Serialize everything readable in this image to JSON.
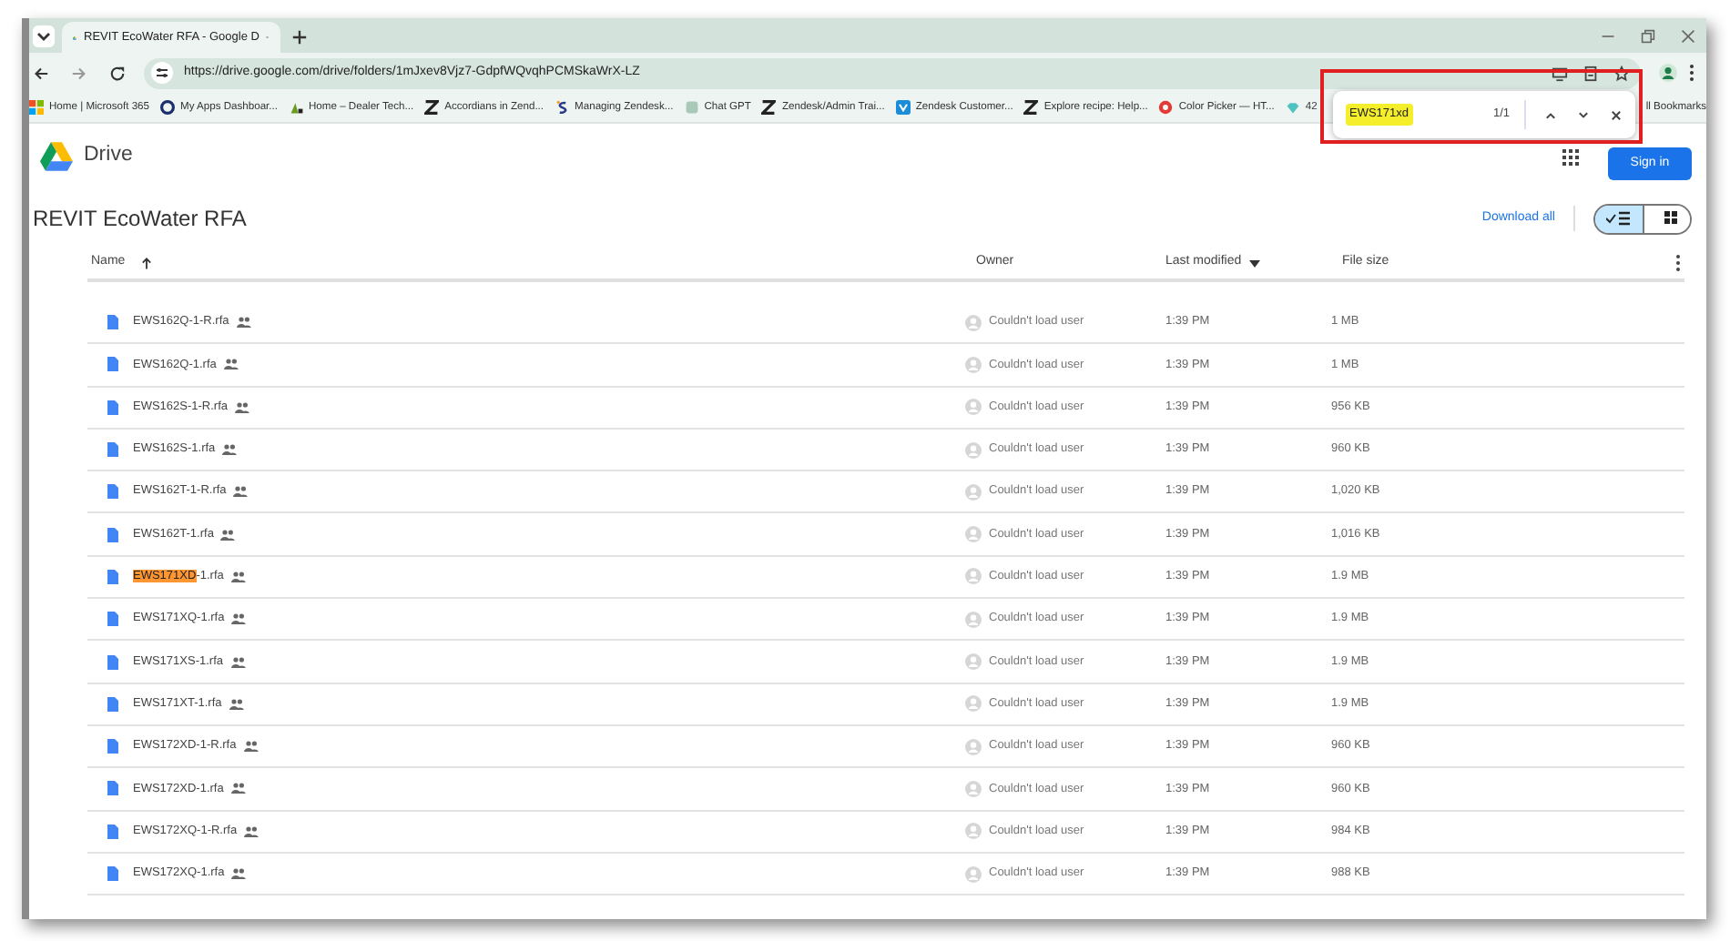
{
  "browser": {
    "tab": {
      "title": "REVIT EcoWater RFA - Google D",
      "selected": true
    },
    "url": "https://drive.google.com/drive/folders/1mJxev8Vjz7-GdpfWQvqhPCMSkaWrX-LZ",
    "bookmarks": [
      "Home | Microsoft 365",
      "My Apps Dashboar...",
      "Home – Dealer Tech...",
      "Accordians in Zend...",
      "Managing Zendesk...",
      "Chat GPT",
      "Zendesk/Admin Trai...",
      "Zendesk Customer...",
      "Explore recipe: Help...",
      "Color Picker — HT...",
      "42"
    ],
    "bookmarks_end": "ll Bookmarks",
    "find_bar": {
      "query": "EWS171xd",
      "count": "1/1"
    }
  },
  "drive": {
    "logo_text": "Drive",
    "sign_in": "Sign in",
    "folder_title": "REVIT EcoWater RFA",
    "download_all": "Download all",
    "view_toggle": [
      {
        "kind": "list",
        "selected": true
      },
      {
        "kind": "grid",
        "selected": false
      }
    ],
    "columns": [
      "Name",
      "Owner",
      "Last modified",
      "File size"
    ],
    "rows": [
      {
        "name": "EWS162Q-1-R.rfa",
        "owner": "Couldn't load user",
        "modified": "1:39 PM",
        "size": "1 MB"
      },
      {
        "name": "EWS162Q-1.rfa",
        "owner": "Couldn't load user",
        "modified": "1:39 PM",
        "size": "1 MB"
      },
      {
        "name": "EWS162S-1-R.rfa",
        "owner": "Couldn't load user",
        "modified": "1:39 PM",
        "size": "956 KB"
      },
      {
        "name": "EWS162S-1.rfa",
        "owner": "Couldn't load user",
        "modified": "1:39 PM",
        "size": "960 KB"
      },
      {
        "name": "EWS162T-1-R.rfa",
        "owner": "Couldn't load user",
        "modified": "1:39 PM",
        "size": "1,020 KB"
      },
      {
        "name": "EWS162T-1.rfa",
        "owner": "Couldn't load user",
        "modified": "1:39 PM",
        "size": "1,016 KB"
      },
      {
        "match": "EWS171XD",
        "name": "-1.rfa",
        "owner": "Couldn't load user",
        "modified": "1:39 PM",
        "size": "1.9 MB"
      },
      {
        "name": "EWS171XQ-1.rfa",
        "owner": "Couldn't load user",
        "modified": "1:39 PM",
        "size": "1.9 MB"
      },
      {
        "name": "EWS171XS-1.rfa",
        "owner": "Couldn't load user",
        "modified": "1:39 PM",
        "size": "1.9 MB"
      },
      {
        "name": "EWS171XT-1.rfa",
        "owner": "Couldn't load user",
        "modified": "1:39 PM",
        "size": "1.9 MB"
      },
      {
        "name": "EWS172XD-1-R.rfa",
        "owner": "Couldn't load user",
        "modified": "1:39 PM",
        "size": "960 KB"
      },
      {
        "name": "EWS172XD-1.rfa",
        "owner": "Couldn't load user",
        "modified": "1:39 PM",
        "size": "960 KB"
      },
      {
        "name": "EWS172XQ-1-R.rfa",
        "owner": "Couldn't load user",
        "modified": "1:39 PM",
        "size": "984 KB"
      },
      {
        "name": "EWS172XQ-1.rfa",
        "owner": "Couldn't load user",
        "modified": "1:39 PM",
        "size": "988 KB"
      }
    ]
  }
}
